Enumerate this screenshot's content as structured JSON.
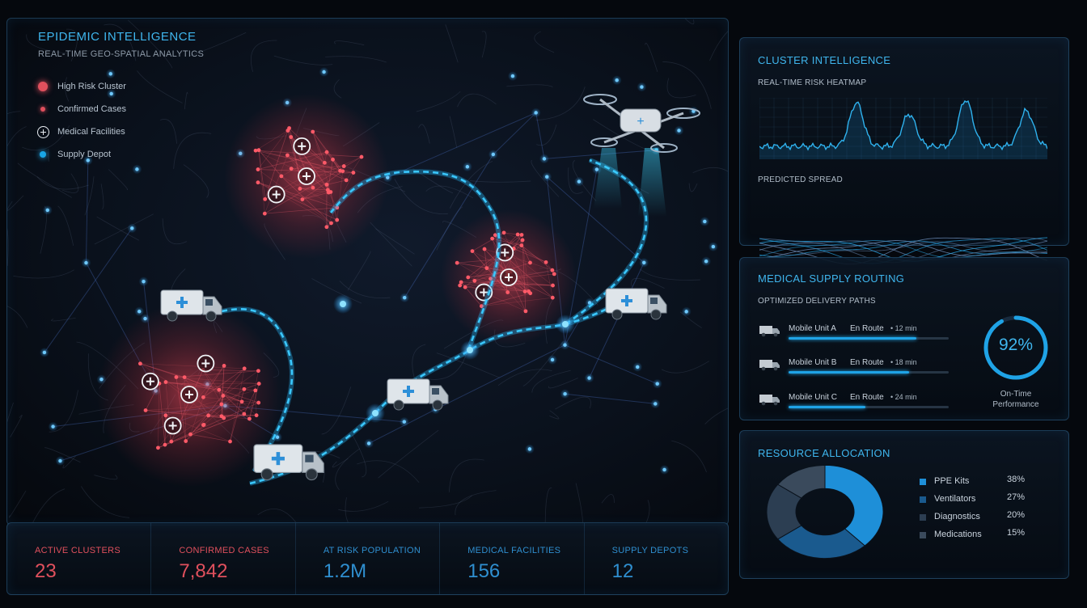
{
  "map": {
    "title": "EPIDEMIC INTELLIGENCE",
    "subtitle": "REAL-TIME GEO-SPATIAL ANALYTICS",
    "legend": [
      {
        "label": "High Risk Cluster",
        "icon": "high-risk-cluster-icon"
      },
      {
        "label": "Confirmed Cases",
        "icon": "confirmed-case-icon"
      },
      {
        "label": "Medical Facilities",
        "icon": "medical-facility-icon"
      },
      {
        "label": "Supply Depot",
        "icon": "supply-depot-icon"
      }
    ],
    "colors": {
      "cluster": "#e0505d",
      "route": "#19a6e6",
      "accent": "#3fb6ee"
    }
  },
  "stats": [
    {
      "label": "ACTIVE CLUSTERS",
      "value": "23",
      "color": "#e0505d"
    },
    {
      "label": "CONFIRMED CASES",
      "value": "7,842",
      "color": "#e0505d"
    },
    {
      "label": "AT RISK POPULATION",
      "value": "1.2M",
      "color": "#2f8fd0"
    },
    {
      "label": "MEDICAL FACILITIES",
      "value": "156",
      "color": "#2f8fd0"
    },
    {
      "label": "SUPPLY DEPOTS",
      "value": "12",
      "color": "#2f8fd0"
    }
  ],
  "cluster_panel": {
    "title": "CLUSTER INTELLIGENCE",
    "heatmap_label": "REAL-TIME RISK HEATMAP",
    "spread_label": "PREDICTED SPREAD"
  },
  "routing_panel": {
    "title": "MEDICAL SUPPLY ROUTING",
    "subtitle": "OPTIMIZED DELIVERY PATHS",
    "units": [
      {
        "name": "Mobile Unit A",
        "status": "En Route",
        "eta": "• 12 min",
        "progress": 0.8
      },
      {
        "name": "Mobile Unit B",
        "status": "En Route",
        "eta": "• 18 min",
        "progress": 0.75
      },
      {
        "name": "Mobile Unit C",
        "status": "En Route",
        "eta": "• 24 min",
        "progress": 0.48
      }
    ],
    "performance_value": "92%",
    "performance_fraction": 0.92,
    "performance_label": "On-Time Performance"
  },
  "resource_panel": {
    "title": "RESOURCE ALLOCATION",
    "items": [
      {
        "name": "PPE Kits",
        "pct": "38%",
        "value": 38,
        "color": "#1e8fd8"
      },
      {
        "name": "Ventilators",
        "pct": "27%",
        "value": 27,
        "color": "#1a5a8e"
      },
      {
        "name": "Diagnostics",
        "pct": "20%",
        "value": 20,
        "color": "#2c3e52"
      },
      {
        "name": "Medications",
        "pct": "15%",
        "value": 15,
        "color": "#3a4a5c"
      }
    ]
  }
}
